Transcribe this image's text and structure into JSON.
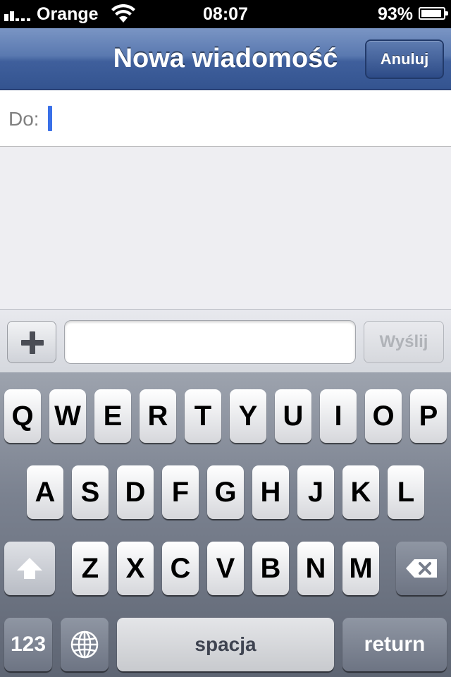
{
  "status_bar": {
    "carrier": "Orange",
    "time": "08:07",
    "battery_percent": "93%",
    "battery_level": 0.93,
    "wifi_icon": "wifi-icon",
    "signal_icon": "signal-bars-icon"
  },
  "nav_bar": {
    "title": "Nowa wiadomość",
    "cancel_label": "Anuluj"
  },
  "to_field": {
    "label": "Do:",
    "value": ""
  },
  "compose": {
    "add_icon": "plus-icon",
    "message_value": "",
    "send_label": "Wyślij"
  },
  "keyboard": {
    "row1": [
      "Q",
      "W",
      "E",
      "R",
      "T",
      "Y",
      "U",
      "I",
      "O",
      "P"
    ],
    "row2": [
      "A",
      "S",
      "D",
      "F",
      "G",
      "H",
      "J",
      "K",
      "L"
    ],
    "row3": [
      "Z",
      "X",
      "C",
      "V",
      "B",
      "N",
      "M"
    ],
    "shift_icon": "shift-arrow-icon",
    "backspace_icon": "backspace-icon",
    "numbers_label": "123",
    "globe_icon": "globe-icon",
    "space_label": "spacja",
    "return_label": "return"
  },
  "colors": {
    "nav_bar": "#4a68a4",
    "cursor": "#3a70e8",
    "keyboard": "#7b8290"
  }
}
